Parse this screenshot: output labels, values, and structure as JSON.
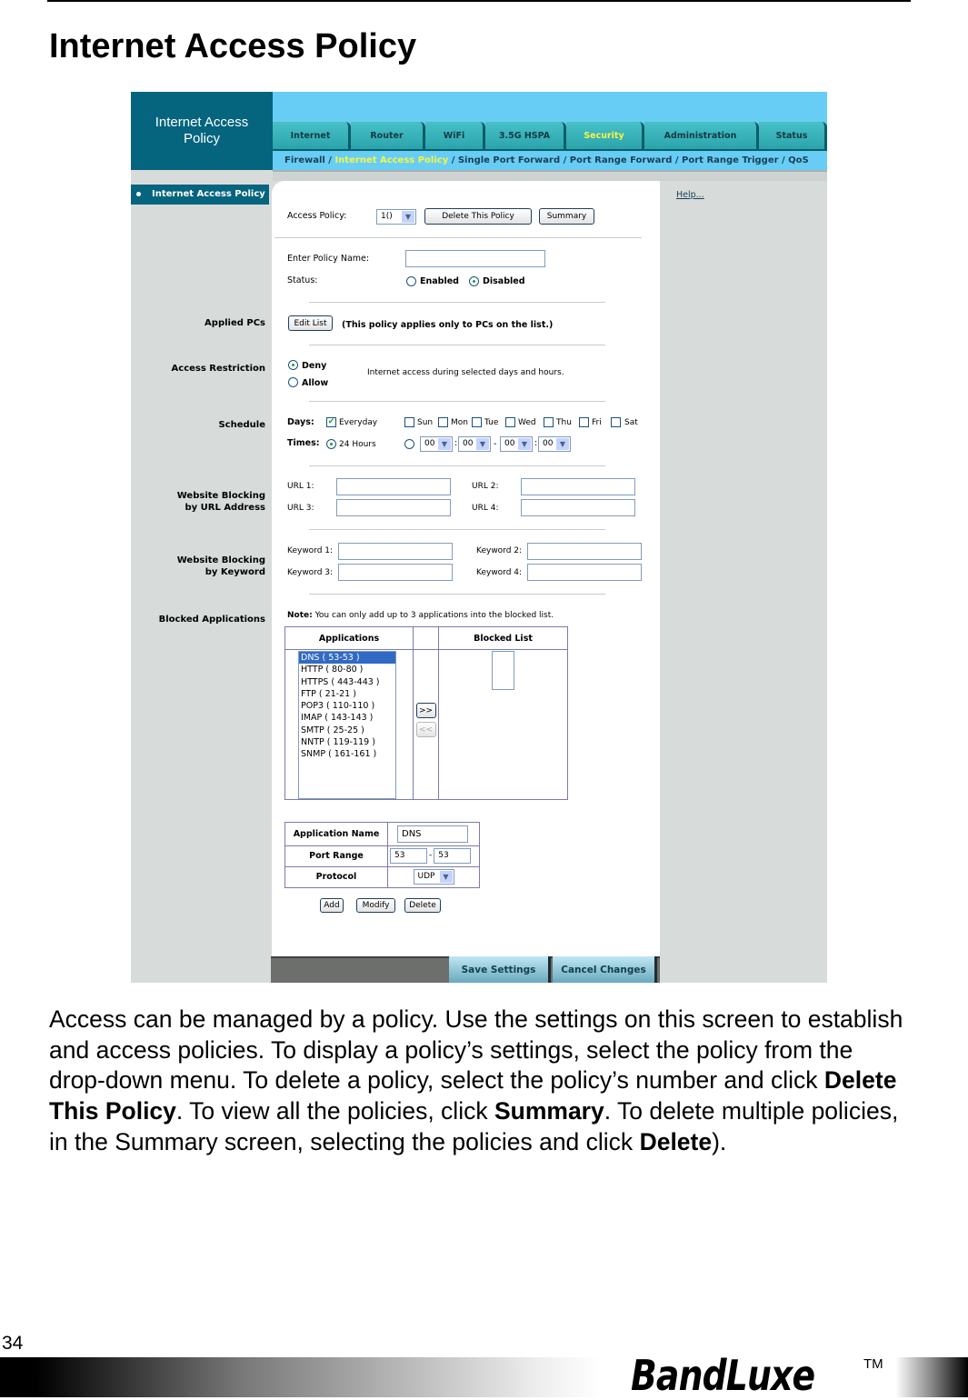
{
  "page": {
    "title": "Internet Access Policy",
    "page_number": "34",
    "brand": "BandLuxe",
    "trademark": "TM"
  },
  "router_ui": {
    "header_title_line1": "Internet Access",
    "header_title_line2": "Policy",
    "tabs": [
      {
        "label": "Internet",
        "active": false
      },
      {
        "label": "Router",
        "active": false
      },
      {
        "label": "WiFi",
        "active": false
      },
      {
        "label": "3.5G HSPA",
        "active": false
      },
      {
        "label": "Security",
        "active": true
      },
      {
        "label": "Administration",
        "active": false
      },
      {
        "label": "Status",
        "active": false
      }
    ],
    "subnav": {
      "firewall": "Firewall",
      "sep": " / ",
      "current": "Internet Access Policy",
      "rest": " / Single Port Forward / Port Range Forward /  Port Range Trigger  /  QoS"
    },
    "sidebar_item": "Internet Access Policy",
    "help_link": "Help...",
    "access_policy": {
      "label": "Access Policy:",
      "selected": "1()",
      "delete_button": "Delete This Policy",
      "summary_button": "Summary"
    },
    "policy_name": {
      "label": "Enter Policy Name:",
      "value": ""
    },
    "status": {
      "label": "Status:",
      "options": [
        "Enabled",
        "Disabled"
      ],
      "selected": "Disabled"
    },
    "applied_pcs": {
      "section": "Applied PCs",
      "button": "Edit List",
      "note": "(This policy applies only to PCs on the list.)"
    },
    "access_restriction": {
      "section": "Access Restriction",
      "options": [
        "Deny",
        "Allow"
      ],
      "selected": "Deny",
      "note": "Internet access during selected days and hours."
    },
    "schedule": {
      "section": "Schedule",
      "days_label": "Days:",
      "everyday": {
        "label": "Everyday",
        "checked": true
      },
      "days": [
        {
          "label": "Sun",
          "checked": false
        },
        {
          "label": "Mon",
          "checked": false
        },
        {
          "label": "Tue",
          "checked": false
        },
        {
          "label": "Wed",
          "checked": false
        },
        {
          "label": "Thu",
          "checked": false
        },
        {
          "label": "Fri",
          "checked": false
        },
        {
          "label": "Sat",
          "checked": false
        }
      ],
      "times_label": "Times:",
      "hours24": {
        "label": "24 Hours",
        "selected": true
      },
      "time_selects": [
        "00",
        "00",
        "00",
        "00"
      ],
      "colon": ":",
      "dash": "-"
    },
    "url_blocking": {
      "section_line1": "Website Blocking",
      "section_line2": "by URL Address",
      "fields": [
        {
          "label": "URL 1:",
          "value": ""
        },
        {
          "label": "URL 2:",
          "value": ""
        },
        {
          "label": "URL 3:",
          "value": ""
        },
        {
          "label": "URL 4:",
          "value": ""
        }
      ]
    },
    "keyword_blocking": {
      "section_line1": "Website Blocking",
      "section_line2": "by Keyword",
      "fields": [
        {
          "label": "Keyword 1:",
          "value": ""
        },
        {
          "label": "Keyword 2:",
          "value": ""
        },
        {
          "label": "Keyword 3:",
          "value": ""
        },
        {
          "label": "Keyword 4:",
          "value": ""
        }
      ]
    },
    "blocked_apps": {
      "section": "Blocked Applications",
      "note_bold": "Note:",
      "note_text": " You can only add up to 3 applications into the blocked list.",
      "applications_header": "Applications",
      "blocked_header": "Blocked List",
      "applications": [
        "DNS ( 53-53 )",
        "HTTP ( 80-80 )",
        "HTTPS ( 443-443 )",
        "FTP ( 21-21 )",
        "POP3 ( 110-110 )",
        "IMAP ( 143-143 )",
        "SMTP ( 25-25 )",
        "NNTP ( 119-119 )",
        "SNMP ( 161-161 )"
      ],
      "selected_index": 0,
      "add_arrow": ">>",
      "remove_arrow": "<<"
    },
    "app_editor": {
      "name_label": "Application Name",
      "name_value": "DNS",
      "port_label": "Port Range",
      "port_from": "53",
      "port_to": "53",
      "protocol_label": "Protocol",
      "protocol_value": "UDP",
      "add_button": "Add",
      "modify_button": "Modify",
      "delete_button": "Delete"
    },
    "save_button": "Save Settings",
    "cancel_button": "Cancel Changes"
  },
  "description": {
    "p1": "Access can be managed by a policy. Use the settings on this screen to establish and access policies. To display a policy’s settings, select the policy from the drop-down menu. To delete a policy, select the policy’s number and click ",
    "b1": "Delete This Policy",
    "p2": ". To view all the policies, click ",
    "b2": "Summary",
    "p3": ". To delete multiple policies, in the Summary screen, selecting the policies and click ",
    "b3": "Delete",
    "p4": ")."
  }
}
